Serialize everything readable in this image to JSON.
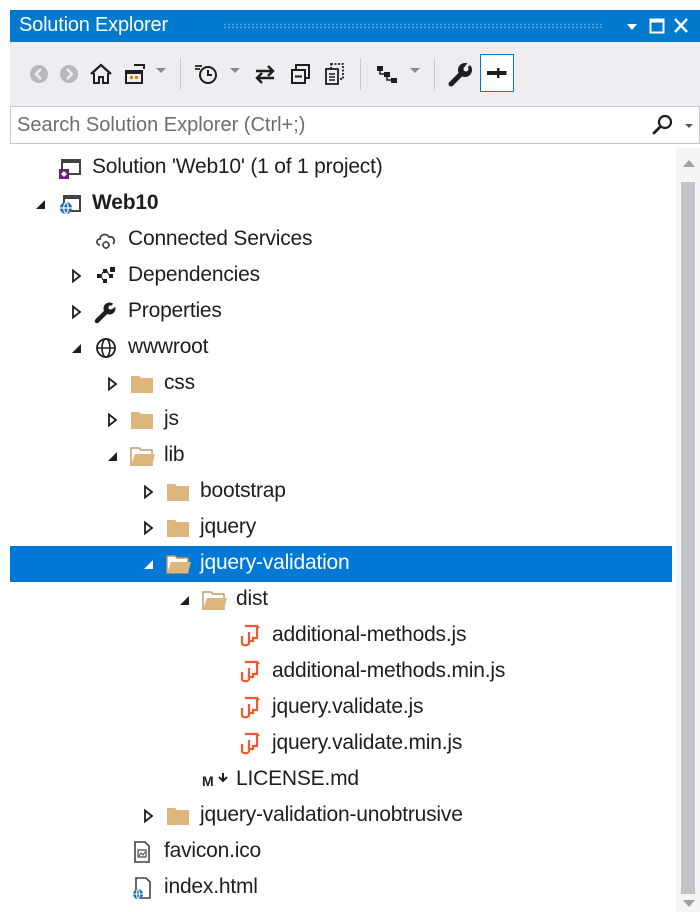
{
  "window": {
    "title": "Solution Explorer",
    "accent_color": "#007acc",
    "selection_color": "#0078d7",
    "title_buttons": [
      "window-position-dropdown",
      "maximize",
      "close"
    ]
  },
  "toolbar": {
    "buttons": [
      "back-icon",
      "forward-icon",
      "home-icon",
      "switch-views-icon",
      "pending-changes-filter-icon",
      "sync-with-active-document-icon",
      "collapse-all-icon",
      "show-all-files-icon",
      "preview-selected-items-icon",
      "properties-icon",
      "auto-hide-pin-icon"
    ]
  },
  "search": {
    "placeholder": "Search Solution Explorer (Ctrl+;)",
    "value": ""
  },
  "tree": {
    "rows": [
      {
        "label": "Solution 'Web10' (1 of 1 project)",
        "icon": "solution-icon",
        "expander": "none",
        "depth": 0,
        "bold": false,
        "selected": false
      },
      {
        "label": "Web10",
        "icon": "web-project-icon",
        "expander": "expanded",
        "depth": 0,
        "bold": true,
        "selected": false
      },
      {
        "label": "Connected Services",
        "icon": "connected-services-icon",
        "expander": "none",
        "depth": 1,
        "bold": false,
        "selected": false
      },
      {
        "label": "Dependencies",
        "icon": "dependencies-icon",
        "expander": "collapsed",
        "depth": 1,
        "bold": false,
        "selected": false
      },
      {
        "label": "Properties",
        "icon": "wrench-icon",
        "expander": "collapsed",
        "depth": 1,
        "bold": false,
        "selected": false
      },
      {
        "label": "wwwroot",
        "icon": "globe-icon",
        "expander": "expanded",
        "depth": 1,
        "bold": false,
        "selected": false
      },
      {
        "label": "css",
        "icon": "folder-icon",
        "expander": "collapsed",
        "depth": 2,
        "bold": false,
        "selected": false
      },
      {
        "label": "js",
        "icon": "folder-icon",
        "expander": "collapsed",
        "depth": 2,
        "bold": false,
        "selected": false
      },
      {
        "label": "lib",
        "icon": "folder-open-icon",
        "expander": "expanded",
        "depth": 2,
        "bold": false,
        "selected": false
      },
      {
        "label": "bootstrap",
        "icon": "folder-icon",
        "expander": "collapsed",
        "depth": 3,
        "bold": false,
        "selected": false
      },
      {
        "label": "jquery",
        "icon": "folder-icon",
        "expander": "collapsed",
        "depth": 3,
        "bold": false,
        "selected": false
      },
      {
        "label": "jquery-validation",
        "icon": "folder-open-icon",
        "expander": "expanded",
        "depth": 3,
        "bold": false,
        "selected": true
      },
      {
        "label": "dist",
        "icon": "folder-open-icon",
        "expander": "expanded",
        "depth": 4,
        "bold": false,
        "selected": false
      },
      {
        "label": "additional-methods.js",
        "icon": "javascript-file-icon",
        "expander": "none",
        "depth": 5,
        "bold": false,
        "selected": false
      },
      {
        "label": "additional-methods.min.js",
        "icon": "javascript-file-icon",
        "expander": "none",
        "depth": 5,
        "bold": false,
        "selected": false
      },
      {
        "label": "jquery.validate.js",
        "icon": "javascript-file-icon",
        "expander": "none",
        "depth": 5,
        "bold": false,
        "selected": false
      },
      {
        "label": "jquery.validate.min.js",
        "icon": "javascript-file-icon",
        "expander": "none",
        "depth": 5,
        "bold": false,
        "selected": false
      },
      {
        "label": "LICENSE.md",
        "icon": "markdown-file-icon",
        "expander": "none",
        "depth": 4,
        "bold": false,
        "selected": false
      },
      {
        "label": "jquery-validation-unobtrusive",
        "icon": "folder-icon",
        "expander": "collapsed",
        "depth": 3,
        "bold": false,
        "selected": false
      },
      {
        "label": "favicon.ico",
        "icon": "image-file-icon",
        "expander": "none",
        "depth": 2,
        "bold": false,
        "selected": false
      },
      {
        "label": "index.html",
        "icon": "html-file-icon",
        "expander": "none",
        "depth": 2,
        "bold": false,
        "selected": false
      }
    ]
  }
}
